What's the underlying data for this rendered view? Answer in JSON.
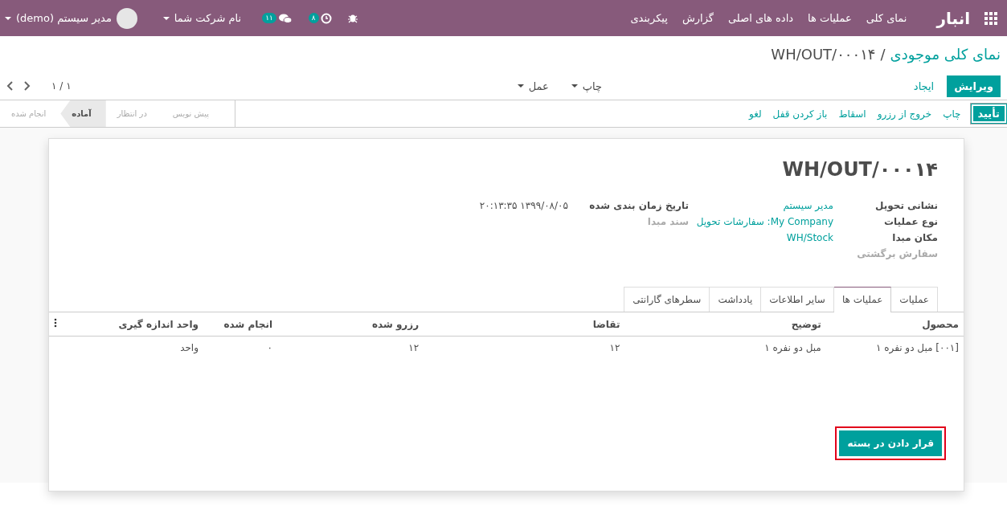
{
  "navbar": {
    "app_name": "انبار",
    "menu": [
      "نمای کلی",
      "عملیات ها",
      "داده های اصلی",
      "گزارش",
      "پیکربندی"
    ],
    "activity_count": "۸",
    "message_count": "۱۱",
    "company": "نام شرکت شما",
    "user": "مدیر سیستم (demo)"
  },
  "breadcrumb": {
    "parent": "نمای کلی موجودی",
    "separator": "/",
    "current": "WH/OUT/۰۰۰۱۴"
  },
  "control_panel": {
    "buttons": [
      {
        "label": "ویرایش",
        "kind": "primary"
      },
      {
        "label": "ایجاد",
        "kind": "link"
      }
    ],
    "dropdowns": [
      "چاپ",
      "عمل"
    ],
    "pager": "۱ / ۱"
  },
  "header_buttons": [
    {
      "label": "تأیید",
      "kind": "primary"
    },
    {
      "label": "چاپ",
      "kind": "link"
    },
    {
      "label": "خروج از رزرو",
      "kind": "link"
    },
    {
      "label": "اسقاط",
      "kind": "link"
    },
    {
      "label": "باز کردن قفل",
      "kind": "link"
    },
    {
      "label": "لغو",
      "kind": "link"
    }
  ],
  "stages": [
    {
      "label": "پیش نویس",
      "selected": false
    },
    {
      "label": "در انتظار",
      "selected": false
    },
    {
      "label": "آماده",
      "selected": true
    },
    {
      "label": "انجام شده",
      "selected": false
    }
  ],
  "form": {
    "title": "WH/OUT/۰۰۰۱۴",
    "fields_left": [
      {
        "label": "نشانی تحویل",
        "value": "مدیر سیستم",
        "muted": false
      },
      {
        "label": "نوع عملیات",
        "value": "My Company: سفارشات تحویل",
        "muted": false
      },
      {
        "label": "مکان مبدا",
        "value": "WH/Stock",
        "muted": false
      },
      {
        "label": "سفارش برگشتی",
        "muted": true
      }
    ],
    "fields_right": [
      {
        "label": "تاریخ زمان بندی شده",
        "value": "۱۳۹۹/۰۸/۰۵ ۲۰:۱۳:۳۵",
        "muted": false
      },
      {
        "label": "سند مبدا",
        "muted": true
      }
    ],
    "tabs": [
      {
        "label": "عملیات",
        "selected": false
      },
      {
        "label": "عملیات ها",
        "selected": true
      },
      {
        "label": "سایر اطلاعات",
        "selected": false
      },
      {
        "label": "یادداشت",
        "selected": false
      },
      {
        "label": "سطرهای گارانتی",
        "selected": false
      }
    ],
    "table": {
      "columns": [
        "محصول",
        "توضیح",
        "تقاضا",
        "رزرو شده",
        "انجام شده",
        "واحد اندازه گیری"
      ],
      "rows": [
        [
          "[۰۰۱] مبل دو نفره ۱",
          "مبل دو نفره ۱",
          "۱۲",
          "۱۲",
          "۰",
          "واحد"
        ]
      ]
    },
    "action_button": {
      "label": "قرار دادن در بسته",
      "highlighted": true
    }
  }
}
